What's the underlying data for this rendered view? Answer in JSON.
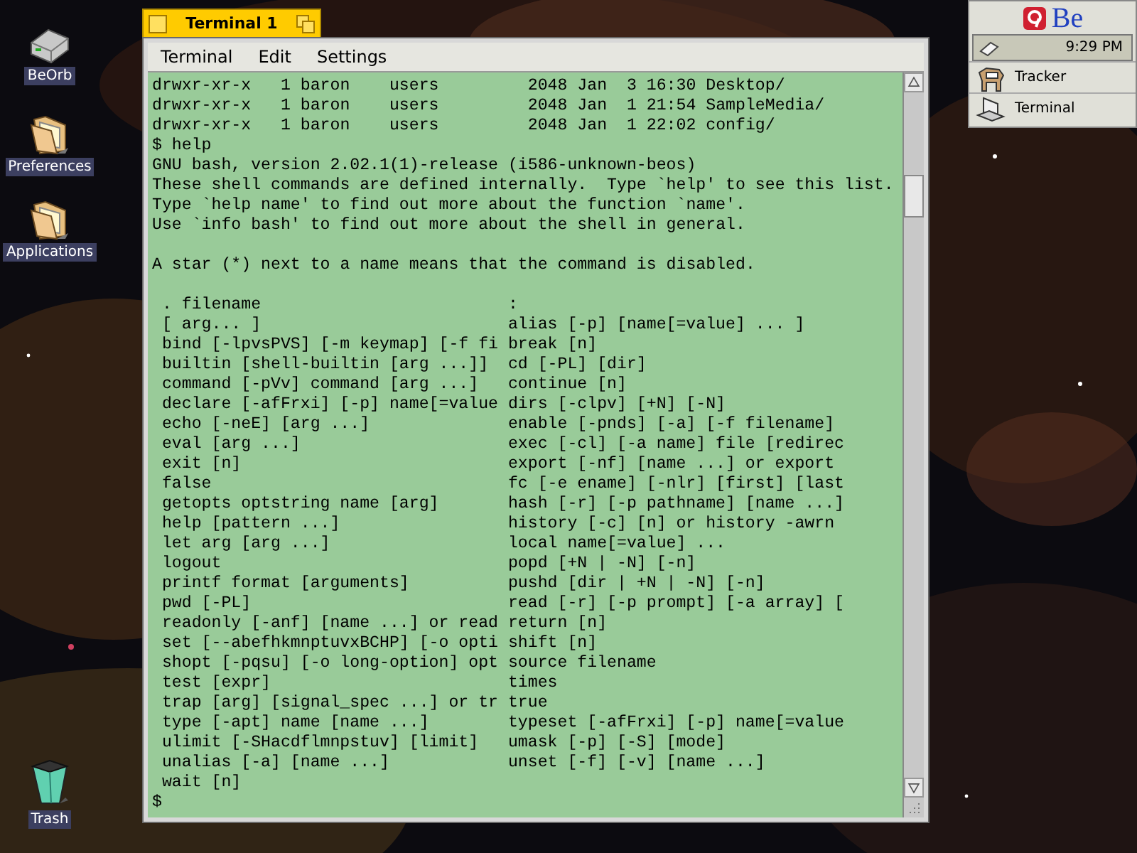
{
  "desktop_icons": [
    {
      "label": "BeOrb",
      "kind": "disk"
    },
    {
      "label": "Preferences",
      "kind": "folder"
    },
    {
      "label": "Applications",
      "kind": "folder"
    },
    {
      "label": "Trash",
      "kind": "trash"
    }
  ],
  "terminal_window": {
    "title": "Terminal 1",
    "menu": [
      "Terminal",
      "Edit",
      "Settings"
    ],
    "output_blocks": [
      [
        "drwxr-xr-x   1 baron    users         2048 Jan  3 16:30 Desktop/",
        "drwxr-xr-x   1 baron    users         2048 Jan  1 21:54 SampleMedia/",
        "drwxr-xr-x   1 baron    users         2048 Jan  1 22:02 config/",
        "$ help",
        "GNU bash, version 2.02.1(1)-release (i586-unknown-beos)",
        "These shell commands are defined internally.  Type `help' to see this list.",
        "Type `help name' to find out more about the function `name'.",
        "Use `info bash' to find out more about the shell in general."
      ],
      [
        "A star (*) next to a name means that the command is disabled."
      ]
    ],
    "help_table": [
      {
        "left": ". filename",
        "right": ":"
      },
      {
        "left": "[ arg... ]",
        "right": "alias [-p] [name[=value] ... ]"
      },
      {
        "left": "bind [-lpvsPVS] [-m keymap] [-f fi",
        "right": "break [n]"
      },
      {
        "left": "builtin [shell-builtin [arg ...]]",
        "right": "cd [-PL] [dir]"
      },
      {
        "left": "command [-pVv] command [arg ...]",
        "right": "continue [n]"
      },
      {
        "left": "declare [-afFrxi] [-p] name[=value",
        "right": "dirs [-clpv] [+N] [-N]"
      },
      {
        "left": "echo [-neE] [arg ...]",
        "right": "enable [-pnds] [-a] [-f filename]"
      },
      {
        "left": "eval [arg ...]",
        "right": "exec [-cl] [-a name] file [redirec"
      },
      {
        "left": "exit [n]",
        "right": "export [-nf] [name ...] or export"
      },
      {
        "left": "false",
        "right": "fc [-e ename] [-nlr] [first] [last"
      },
      {
        "left": "getopts optstring name [arg]",
        "right": "hash [-r] [-p pathname] [name ...]"
      },
      {
        "left": "help [pattern ...]",
        "right": "history [-c] [n] or history -awrn"
      },
      {
        "left": "let arg [arg ...]",
        "right": "local name[=value] ..."
      },
      {
        "left": "logout",
        "right": "popd [+N | -N] [-n]"
      },
      {
        "left": "printf format [arguments]",
        "right": "pushd [dir | +N | -N] [-n]"
      },
      {
        "left": "pwd [-PL]",
        "right": "read [-r] [-p prompt] [-a array] ["
      },
      {
        "left": "readonly [-anf] [name ...] or read",
        "right": "return [n]"
      },
      {
        "left": "set [--abefhkmnptuvxBCHP] [-o opti",
        "right": "shift [n]"
      },
      {
        "left": "shopt [-pqsu] [-o long-option] opt",
        "right": "source filename"
      },
      {
        "left": "test [expr]",
        "right": "times"
      },
      {
        "left": "trap [arg] [signal_spec ...] or tr",
        "right": "true"
      },
      {
        "left": "type [-apt] name [name ...]",
        "right": "typeset [-afFrxi] [-p] name[=value"
      },
      {
        "left": "ulimit [-SHacdflmnpstuv] [limit]",
        "right": "umask [-p] [-S] [mode]"
      },
      {
        "left": "unalias [-a] [name ...]",
        "right": "unset [-f] [-v] [name ...]"
      },
      {
        "left": "wait [n]"
      }
    ],
    "prompt": "$"
  },
  "deskbar": {
    "logo": "Be",
    "clock": "9:29 PM",
    "items": [
      {
        "label": "Tracker",
        "kind": "tracker"
      },
      {
        "label": "Terminal",
        "kind": "terminal"
      }
    ]
  }
}
